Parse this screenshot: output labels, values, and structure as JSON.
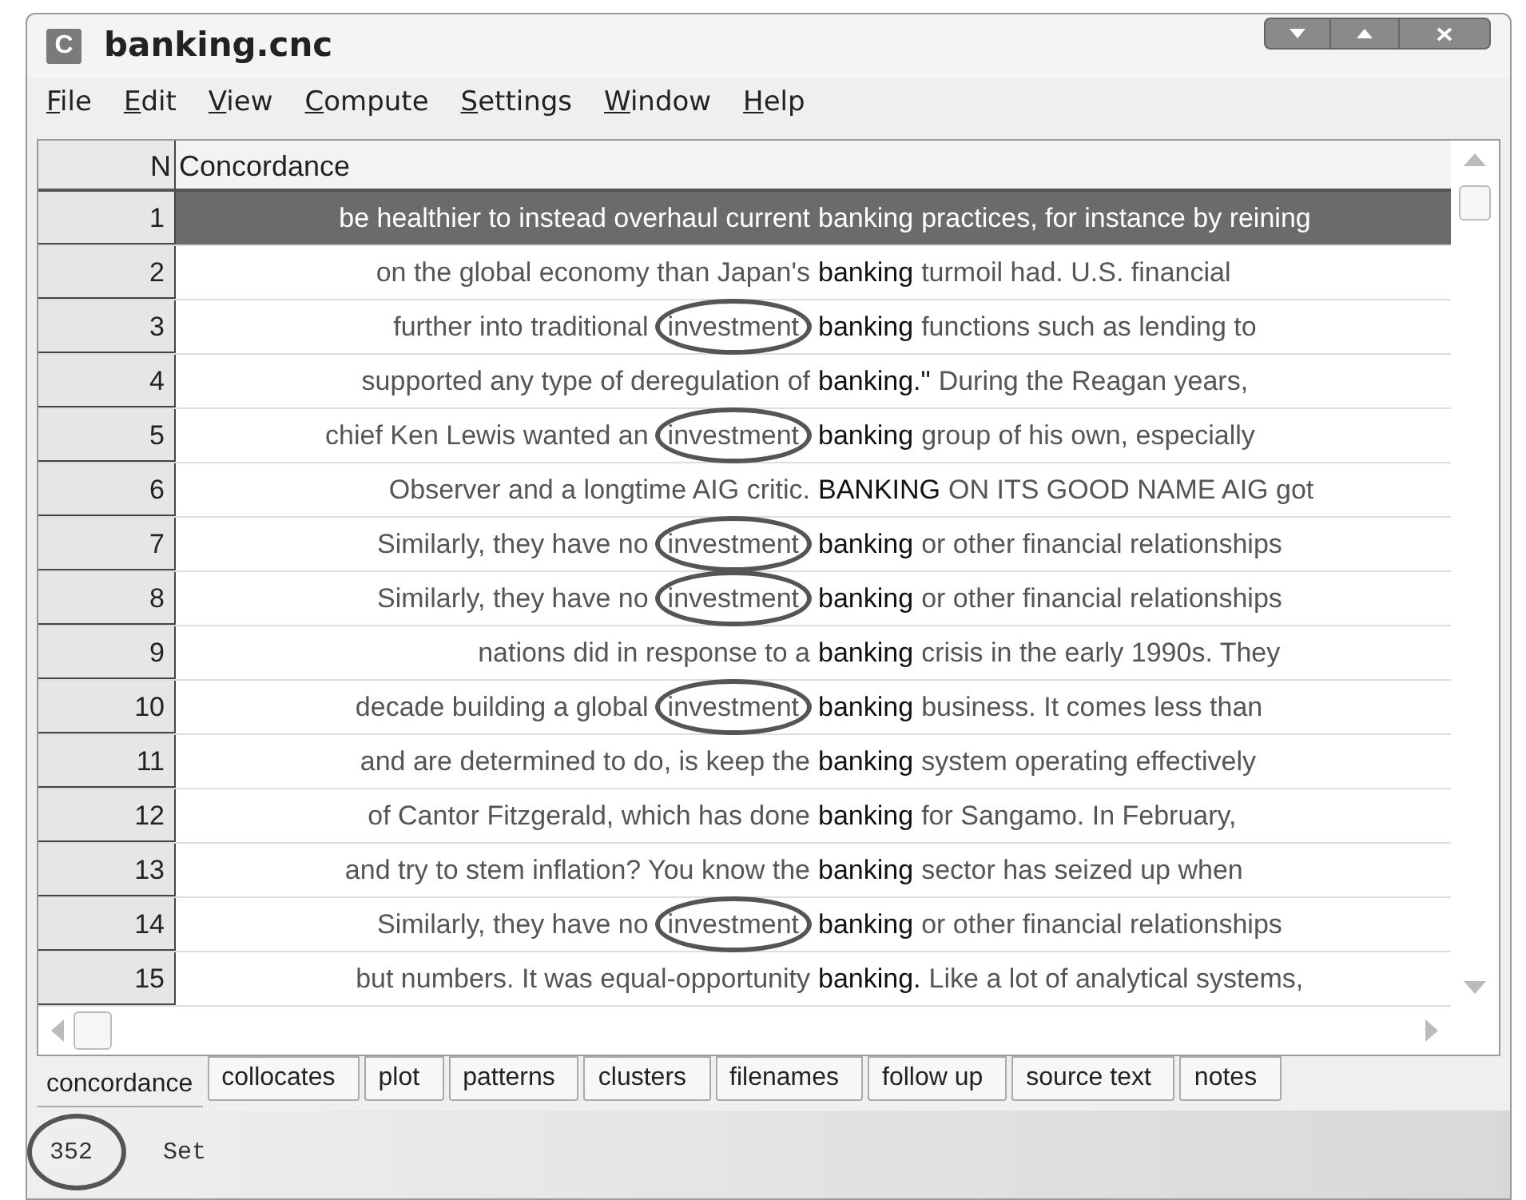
{
  "window": {
    "title": "banking.cnc",
    "icon_letter": "C"
  },
  "menu": [
    {
      "mnemonic": "F",
      "rest": "ile"
    },
    {
      "mnemonic": "E",
      "rest": "dit"
    },
    {
      "mnemonic": "V",
      "rest": "iew"
    },
    {
      "mnemonic": "C",
      "rest": "ompute"
    },
    {
      "mnemonic": "S",
      "rest": "ettings"
    },
    {
      "mnemonic": "W",
      "rest": "indow"
    },
    {
      "mnemonic": "H",
      "rest": "elp"
    }
  ],
  "table": {
    "columns": [
      "N",
      "Concordance"
    ],
    "rows": [
      {
        "n": "1",
        "left": "be healthier to instead overhaul current",
        "node": "banking",
        "right": "practices, for instance by reining",
        "selected": true
      },
      {
        "n": "2",
        "left": "on the global economy than Japan's",
        "node": "banking",
        "right": "turmoil had. U.S. financial",
        "selected": false
      },
      {
        "n": "3",
        "left": "further into traditional",
        "circled": "investment",
        "node": "banking",
        "right": "functions such as lending to",
        "selected": false
      },
      {
        "n": "4",
        "left": "supported any type of deregulation of",
        "node": "banking.\"",
        "right": "During the Reagan years,",
        "selected": false
      },
      {
        "n": "5",
        "left": "chief Ken Lewis wanted an",
        "circled": "investment",
        "node": "banking",
        "right": "group of his own, especially",
        "selected": false
      },
      {
        "n": "6",
        "left": "Observer and a longtime AIG critic.",
        "node": "BANKING",
        "right": "ON ITS GOOD NAME AIG got",
        "selected": false
      },
      {
        "n": "7",
        "left": "Similarly, they have no",
        "circled": "investment",
        "node": "banking",
        "right": "or other financial relationships",
        "selected": false
      },
      {
        "n": "8",
        "left": "Similarly, they have no",
        "circled": "investment",
        "node": "banking",
        "right": "or other financial relationships",
        "selected": false
      },
      {
        "n": "9",
        "left": "nations did in response to a",
        "node": "banking",
        "right": "crisis in the early 1990s. They",
        "selected": false
      },
      {
        "n": "10",
        "left": "decade building a global",
        "circled": "investment",
        "node": "banking",
        "right": "business. It comes less than",
        "selected": false
      },
      {
        "n": "11",
        "left": "and are determined to do, is keep the",
        "node": "banking",
        "right": "system operating effectively",
        "selected": false
      },
      {
        "n": "12",
        "left": "of Cantor Fitzgerald, which has done",
        "node": "banking",
        "right": "for Sangamo. In February,",
        "selected": false
      },
      {
        "n": "13",
        "left": "and try to stem inflation? You know the",
        "node": "banking",
        "right": "sector has seized up when",
        "selected": false
      },
      {
        "n": "14",
        "left": "Similarly, they have no",
        "circled": "investment",
        "node": "banking",
        "right": "or other financial relationships",
        "selected": false
      },
      {
        "n": "15",
        "left": "but numbers. It was equal-opportunity",
        "node": "banking.",
        "right": "Like a lot of analytical systems,",
        "selected": false
      }
    ]
  },
  "tabs": [
    {
      "label": "concordance",
      "selected": true
    },
    {
      "label": "collocates",
      "selected": false
    },
    {
      "label": "plot",
      "selected": false
    },
    {
      "label": "patterns",
      "selected": false
    },
    {
      "label": "clusters",
      "selected": false
    },
    {
      "label": "filenames",
      "selected": false
    },
    {
      "label": "follow up",
      "selected": false
    },
    {
      "label": "source text",
      "selected": false
    },
    {
      "label": "notes",
      "selected": false
    }
  ],
  "status_bar": {
    "count": "352",
    "count_circled": true,
    "text": "Set"
  }
}
